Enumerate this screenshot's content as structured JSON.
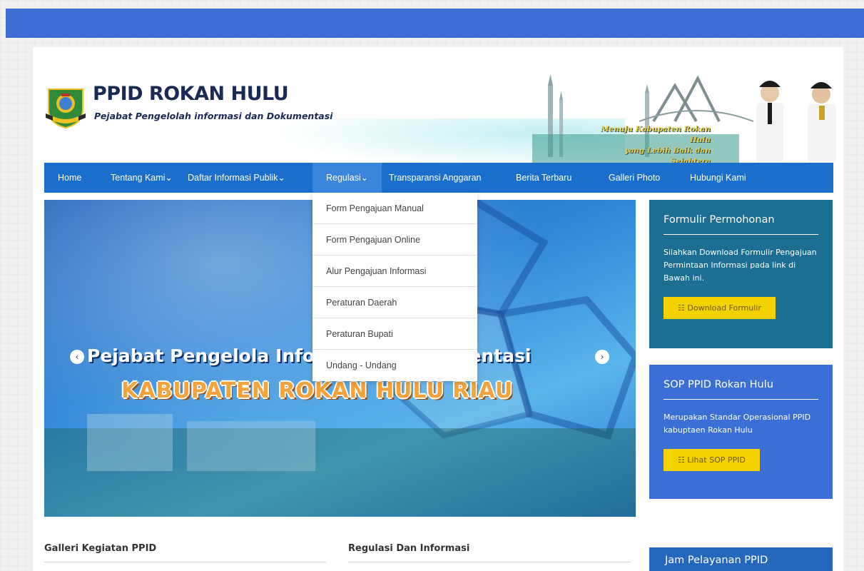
{
  "header": {
    "title": "PPID ROKAN HULU",
    "subtitle": "Pejabat Pengelolah informasi dan Dokumentasi",
    "slogan_line1": "Menuju Kabupaten Rokan Hulu",
    "slogan_line2": "yang Lebih Baik dan Sejahtera"
  },
  "nav": {
    "items": [
      {
        "label": "Home"
      },
      {
        "label": "Tentang Kami⌄"
      },
      {
        "label": "Daftar Informasi Publik⌄"
      },
      {
        "label": "Regulasi⌄"
      },
      {
        "label": "Transparansi Anggaran"
      },
      {
        "label": "Berita Terbaru"
      },
      {
        "label": "Galleri Photo"
      },
      {
        "label": "Hubungi Kami"
      }
    ]
  },
  "dropdown": {
    "items": [
      {
        "label": "Form Pengajuan Manual"
      },
      {
        "label": "Form Pengajuan Online"
      },
      {
        "label": "Alur Pengajuan Informasi"
      },
      {
        "label": "Peraturan Daerah"
      },
      {
        "label": "Peraturan Bupati"
      },
      {
        "label": "Undang - Undang"
      }
    ]
  },
  "slider": {
    "headline": "Pejabat Pengelola Informasi & Dokumentasi",
    "subheadline": "KABUPATEN ROKAN HULU RIAU",
    "prev_icon": "‹",
    "next_icon": "›"
  },
  "widgets": {
    "formulir": {
      "title": "Formulir Permohonan",
      "text": "Silahkan Download Formulir Pengajuan Permintaan Informasi pada link di Bawah ini.",
      "button": "Download Formulir"
    },
    "sop": {
      "title": "SOP PPID Rokan Hulu",
      "text": "Merupakan Standar Operasional PPID kabuptaen Rokan Hulu",
      "button": "Lihat SOP PPID"
    },
    "jam": {
      "title": "Jam Pelayanan PPID"
    }
  },
  "sections": {
    "galleri": "Galleri Kegiatan PPID",
    "regulasi": "Regulasi Dan Informasi"
  },
  "colors": {
    "topbar": "#3f6cd4",
    "nav": "#1a6fcc",
    "widget_teal": "#1c6e92",
    "widget_blue": "#3b6fd6",
    "button_yellow": "#f4d200"
  }
}
